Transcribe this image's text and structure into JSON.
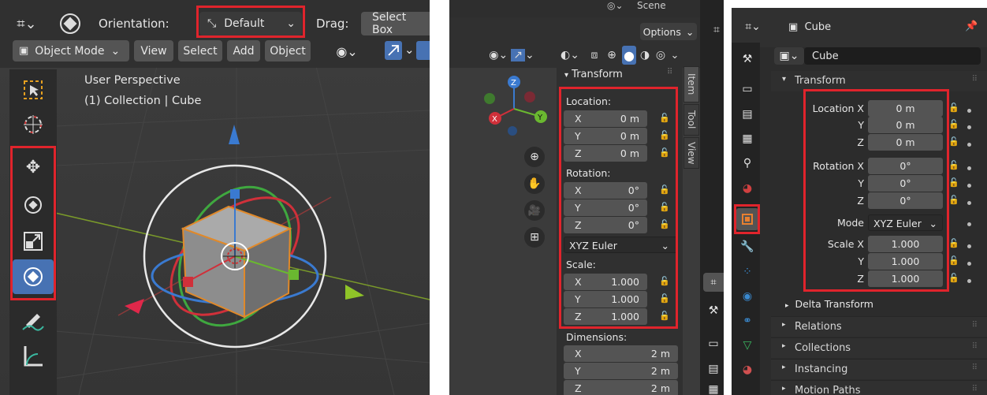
{
  "panel1": {
    "orientation_label": "Orientation:",
    "orientation_value": "Default",
    "drag_label": "Drag:",
    "drag_value": "Select Box",
    "mode": "Object Mode",
    "menu": [
      "View",
      "Select",
      "Add",
      "Object"
    ],
    "perspective": "User Perspective",
    "collection": "(1) Collection | Cube",
    "tools": [
      "select-box-icon",
      "cursor-icon",
      "move-icon",
      "rotate-icon",
      "scale-icon",
      "transform-icon",
      "annotate-icon",
      "measure-icon"
    ]
  },
  "panel2": {
    "scene_label": "Scene",
    "options_label": "Options",
    "transform_header": "Transform",
    "tabs": [
      "Item",
      "Tool",
      "View"
    ],
    "location_label": "Location:",
    "location": [
      {
        "axis": "X",
        "value": "0 m"
      },
      {
        "axis": "Y",
        "value": "0 m"
      },
      {
        "axis": "Z",
        "value": "0 m"
      }
    ],
    "rotation_label": "Rotation:",
    "rotation": [
      {
        "axis": "X",
        "value": "0°"
      },
      {
        "axis": "Y",
        "value": "0°"
      },
      {
        "axis": "Z",
        "value": "0°"
      }
    ],
    "rotation_mode": "XYZ Euler",
    "scale_label": "Scale:",
    "scale": [
      {
        "axis": "X",
        "value": "1.000"
      },
      {
        "axis": "Y",
        "value": "1.000"
      },
      {
        "axis": "Z",
        "value": "1.000"
      }
    ],
    "dimensions_label": "Dimensions:",
    "dimensions": [
      {
        "axis": "X",
        "value": "2 m"
      },
      {
        "axis": "Y",
        "value": "2 m"
      },
      {
        "axis": "Z",
        "value": "2 m"
      }
    ],
    "gizmo": {
      "x": "X",
      "y": "Y",
      "z": "Z"
    }
  },
  "panel3": {
    "object_name": "Cube",
    "data_name": "Cube",
    "transform_header": "Transform",
    "location_x_label": "Location X",
    "location": [
      {
        "axis": "Location X",
        "value": "0 m"
      },
      {
        "axis": "Y",
        "value": "0 m"
      },
      {
        "axis": "Z",
        "value": "0 m"
      }
    ],
    "rotation": [
      {
        "axis": "Rotation X",
        "value": "0°"
      },
      {
        "axis": "Y",
        "value": "0°"
      },
      {
        "axis": "Z",
        "value": "0°"
      }
    ],
    "mode_label": "Mode",
    "mode_value": "XYZ Euler",
    "scale": [
      {
        "axis": "Scale X",
        "value": "1.000"
      },
      {
        "axis": "Y",
        "value": "1.000"
      },
      {
        "axis": "Z",
        "value": "1.000"
      }
    ],
    "delta": "Delta Transform",
    "sections": [
      "Relations",
      "Collections",
      "Instancing",
      "Motion Paths"
    ]
  }
}
